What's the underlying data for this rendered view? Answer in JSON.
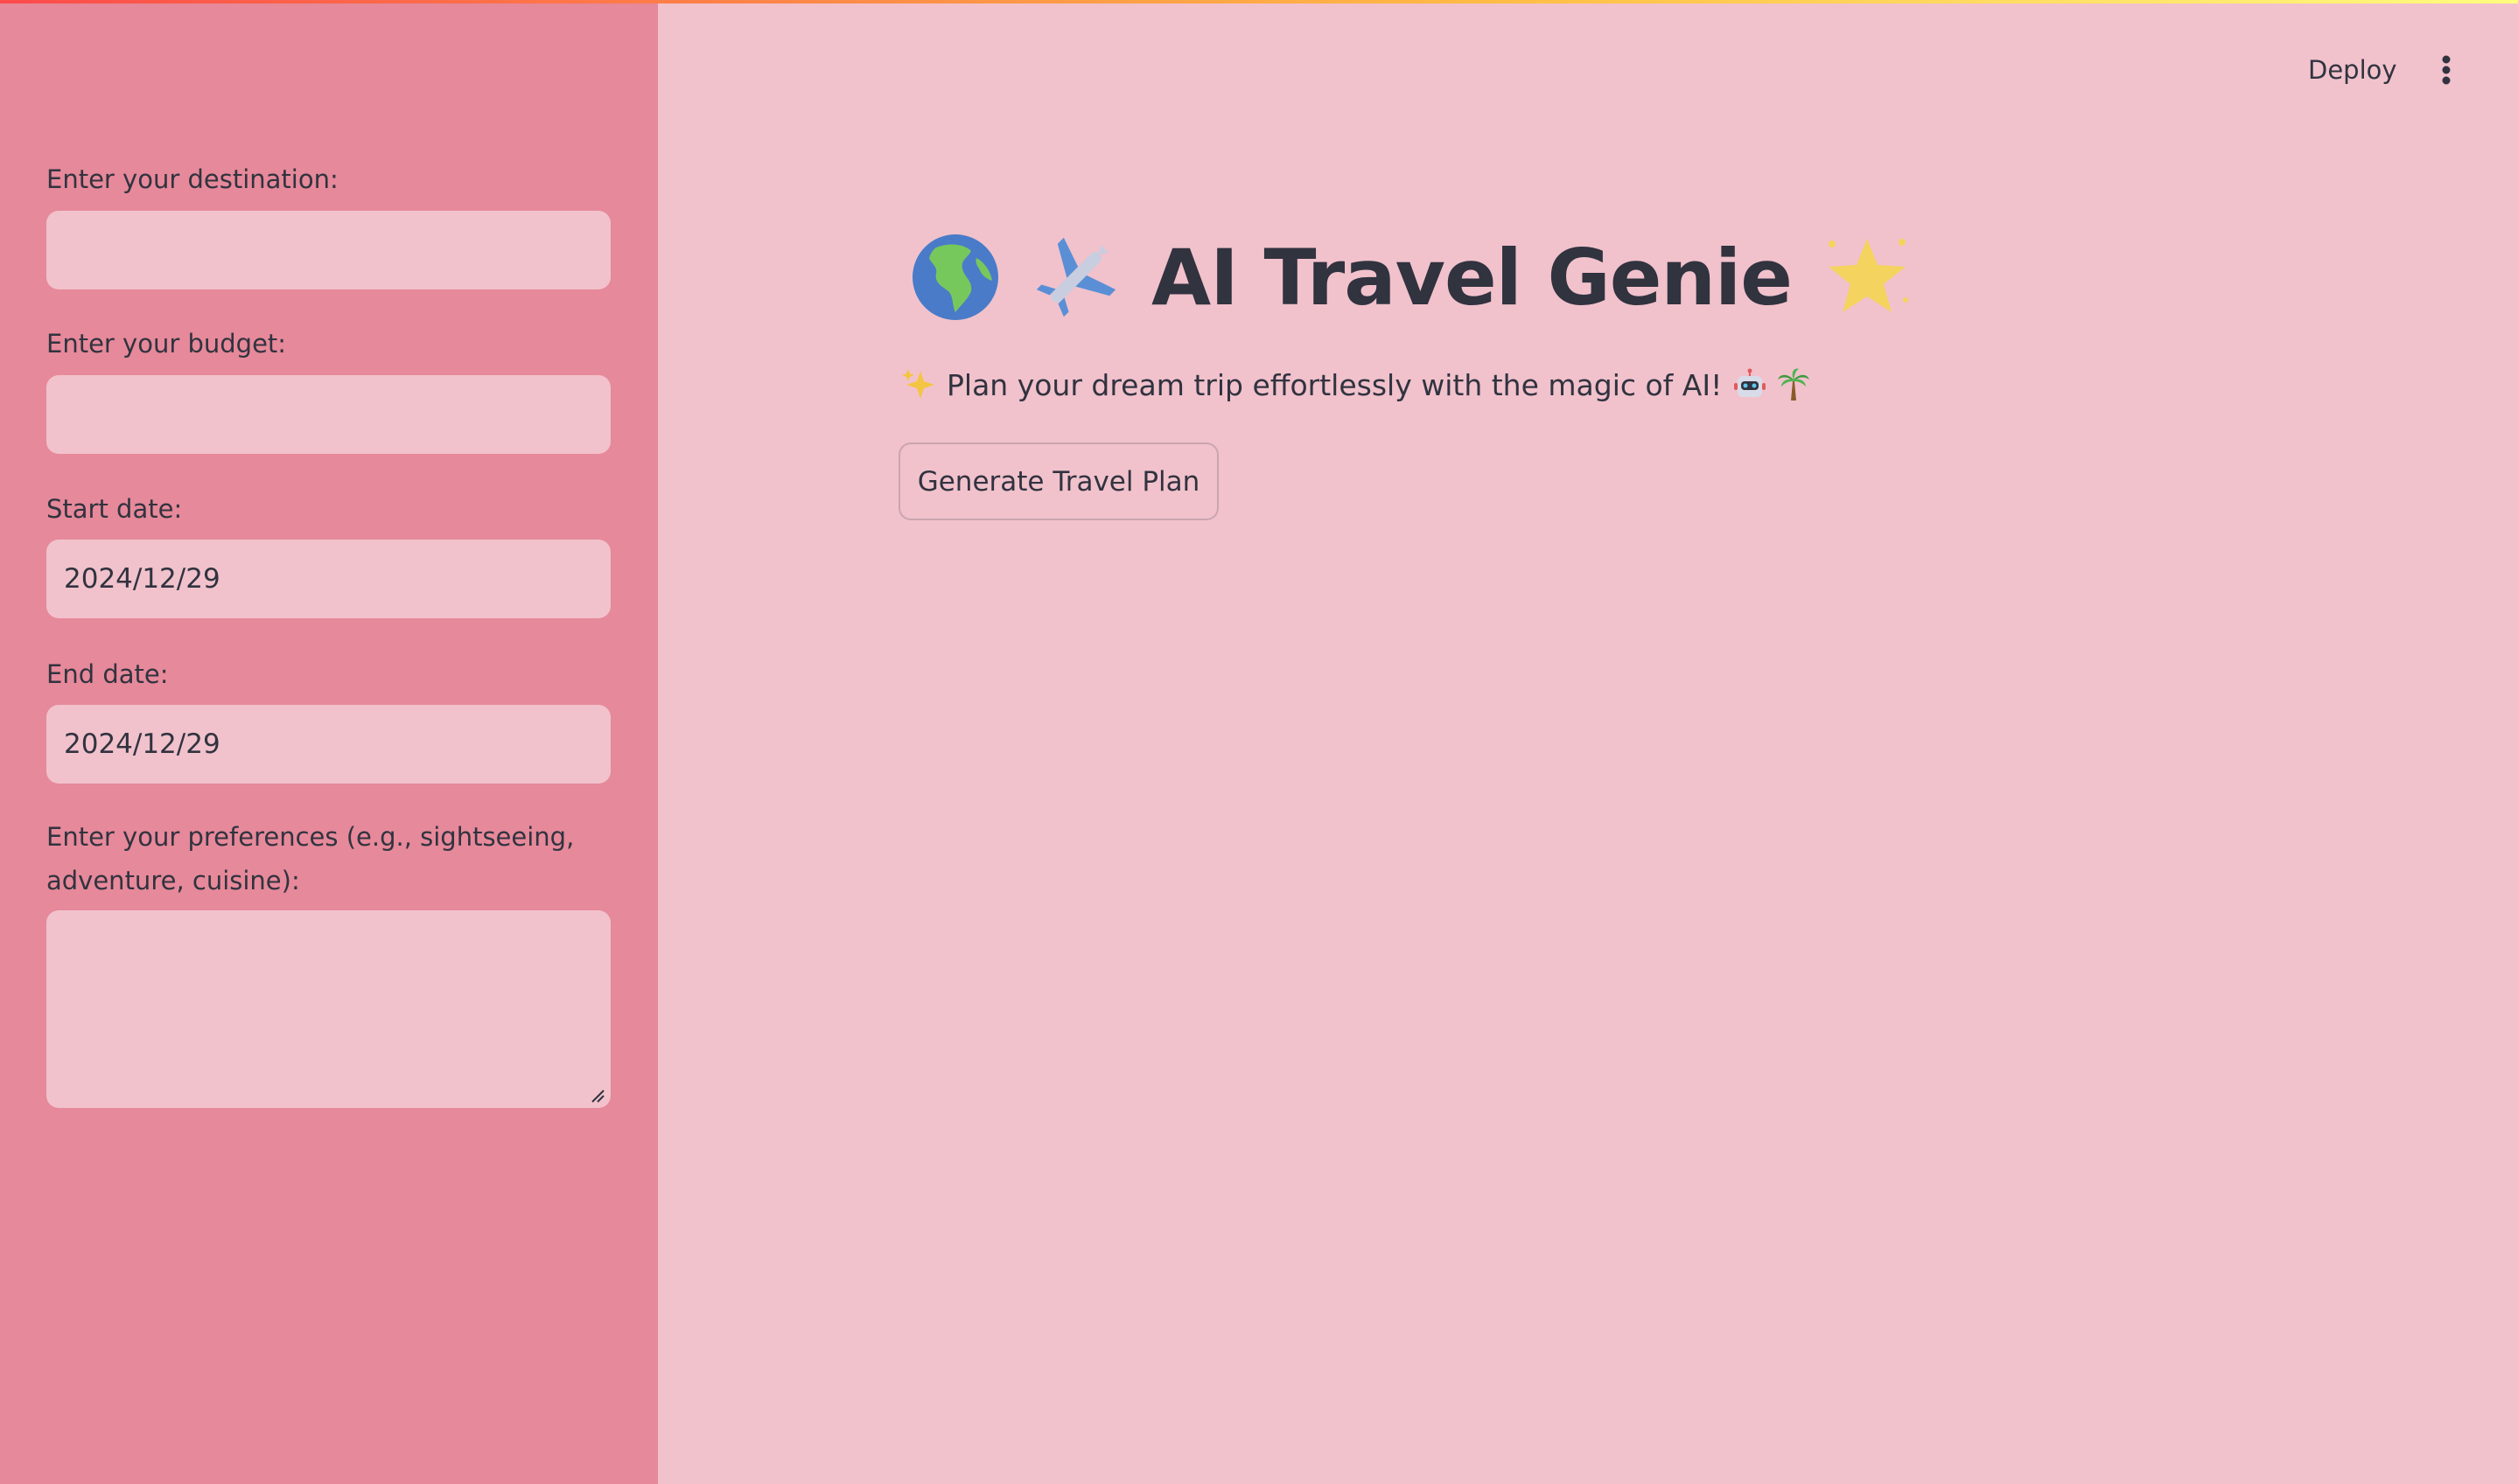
{
  "header": {
    "deploy_label": "Deploy",
    "menu_icon": "kebab-menu-icon"
  },
  "sidebar": {
    "destination": {
      "label": "Enter your destination:",
      "value": ""
    },
    "budget": {
      "label": "Enter your budget:",
      "value": ""
    },
    "start_date": {
      "label": "Start date:",
      "value": "2024/12/29"
    },
    "end_date": {
      "label": "End date:",
      "value": "2024/12/29"
    },
    "preferences": {
      "label": "Enter your preferences (e.g., sightseeing, adventure, cuisine):",
      "value": ""
    }
  },
  "main": {
    "title": "AI Travel Genie",
    "title_icons": [
      "globe-icon",
      "airplane-icon",
      "star-icon"
    ],
    "subtitle": "Plan your dream trip effortlessly with the magic of AI!",
    "subtitle_icons": [
      "sparkles-icon",
      "robot-icon",
      "palm-tree-icon"
    ],
    "generate_button_label": "Generate Travel Plan"
  },
  "colors": {
    "sidebar_bg": "#e6899a",
    "main_bg": "#f1c2cc",
    "text": "#31333f"
  }
}
